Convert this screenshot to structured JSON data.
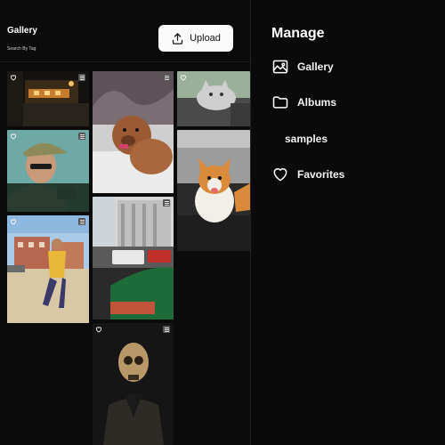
{
  "gallery": {
    "title": "Gallery",
    "search_link": "Search By Tag",
    "upload_label": "Upload"
  },
  "manage": {
    "title": "Manage",
    "items": [
      {
        "label": "Gallery",
        "icon": "image-icon"
      },
      {
        "label": "Albums",
        "icon": "folder-icon"
      },
      {
        "label": "samples"
      },
      {
        "label": "Favorites",
        "icon": "heart-icon"
      }
    ]
  },
  "photos": [
    {
      "subject": "night-street-photo"
    },
    {
      "subject": "brown-poodle-in-snow-photo"
    },
    {
      "subject": "cat-on-sofa-photo"
    },
    {
      "subject": "man-in-cap-photo"
    },
    {
      "subject": "corgi-photo"
    },
    {
      "subject": "man-in-yellow-jacket-photo"
    },
    {
      "subject": "vintage-cars-photo"
    },
    {
      "subject": "skull-portrait-photo"
    }
  ],
  "colors": {
    "background": "#0a0a0b",
    "upload_button": "#fafafa",
    "text": "#ffffff"
  }
}
